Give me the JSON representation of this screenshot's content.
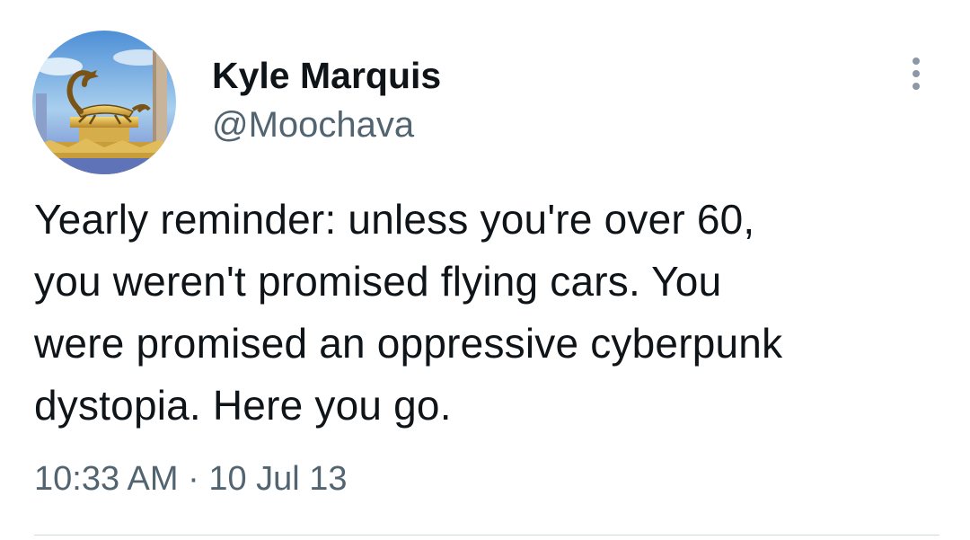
{
  "author": {
    "display_name": "Kyle Marquis",
    "handle": "@Moochava",
    "avatar_icon": "scorpion-relief-avatar"
  },
  "tweet": {
    "text": "Yearly reminder: unless you're over 60,\nyou weren't promised flying cars. You\nwere promised an oppressive cyberpunk\ndystopia. Here you go.",
    "time": "10:33 AM",
    "separator": "·",
    "date": "10 Jul 13"
  },
  "menu": {
    "icon": "more-vertical-icon"
  },
  "colors": {
    "text": "#0f1419",
    "secondary_text": "#536471",
    "divider": "#cfd9de"
  }
}
